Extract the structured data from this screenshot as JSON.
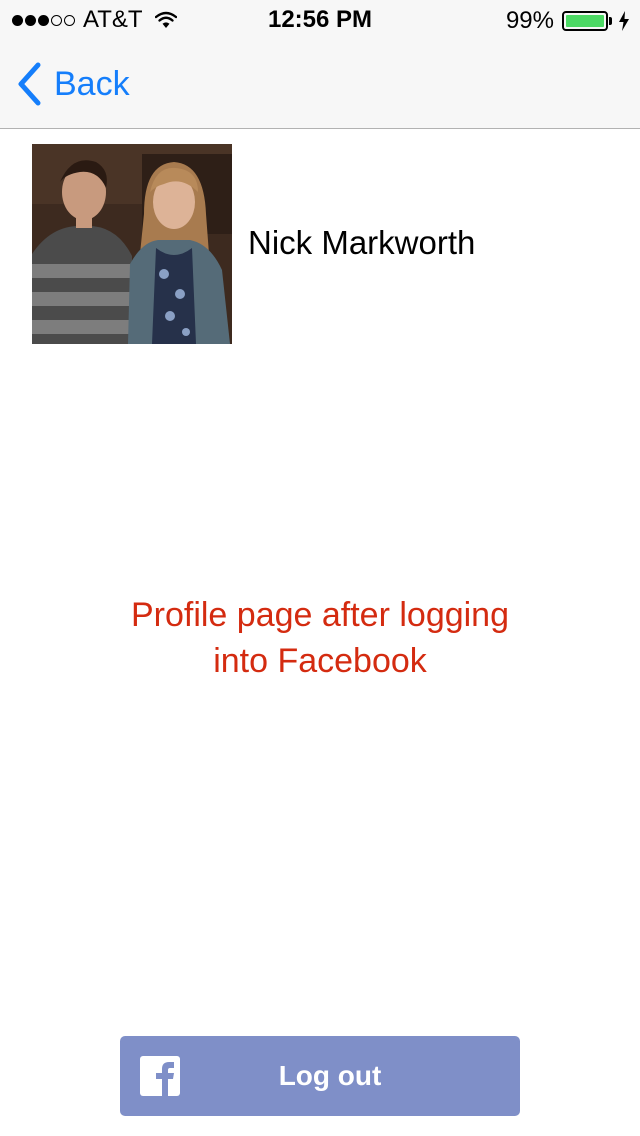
{
  "status_bar": {
    "signal_filled": 3,
    "signal_total": 5,
    "carrier": "AT&T",
    "time": "12:56 PM",
    "battery_percent": "99%",
    "battery_level": 0.99,
    "battery_color": "#4cd964",
    "icons": [
      "wifi-icon",
      "battery-icon",
      "charging-bolt-icon"
    ]
  },
  "nav": {
    "back_label": "Back",
    "accent_color": "#157efb",
    "back_icon": "chevron-left-icon"
  },
  "profile": {
    "name": "Nick Markworth",
    "photo": "profile-photo"
  },
  "note": {
    "text": "Profile page after logging into Facebook",
    "color": "#d42b10"
  },
  "logout": {
    "label": "Log out",
    "icon": "facebook-icon",
    "color": "#7f8fc8"
  }
}
